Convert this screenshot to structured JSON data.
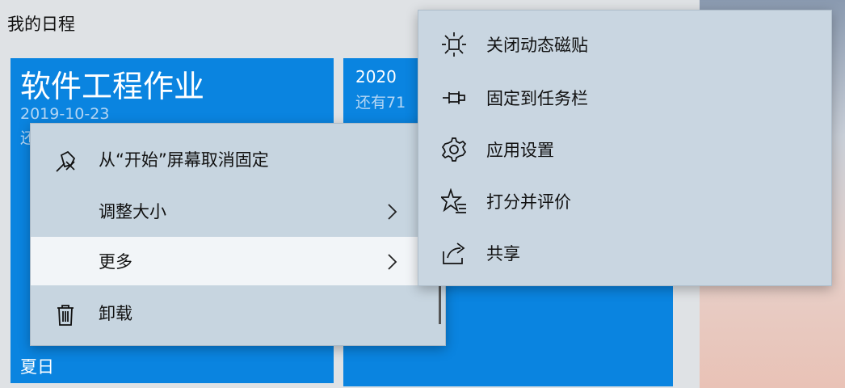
{
  "group": {
    "title": "我的日程"
  },
  "tiles": {
    "a": {
      "title": "软件工程作业",
      "date": "2019-10-23",
      "line2": "还",
      "footer": "夏日"
    },
    "b": {
      "year": "2020",
      "remain": "还有71"
    }
  },
  "context_menu": {
    "items": [
      {
        "label": "从“开始”屏幕取消固定",
        "icon": "unpin-icon"
      },
      {
        "label": "调整大小",
        "icon": "none",
        "has_submenu": true
      },
      {
        "label": "更多",
        "icon": "none",
        "has_submenu": true,
        "highlighted": true
      },
      {
        "label": "卸载",
        "icon": "trash-icon"
      }
    ]
  },
  "submenu": {
    "items": [
      {
        "label": "关闭动态磁贴",
        "icon": "live-tile-off-icon"
      },
      {
        "label": "固定到任务栏",
        "icon": "pin-icon"
      },
      {
        "label": "应用设置",
        "icon": "gear-icon"
      },
      {
        "label": "打分并评价",
        "icon": "star-rate-icon"
      },
      {
        "label": "共享",
        "icon": "share-icon"
      }
    ]
  },
  "colors": {
    "tile": "#0a84e0",
    "menu": "#c7d5e0",
    "highlight": "#f2f5f8"
  }
}
